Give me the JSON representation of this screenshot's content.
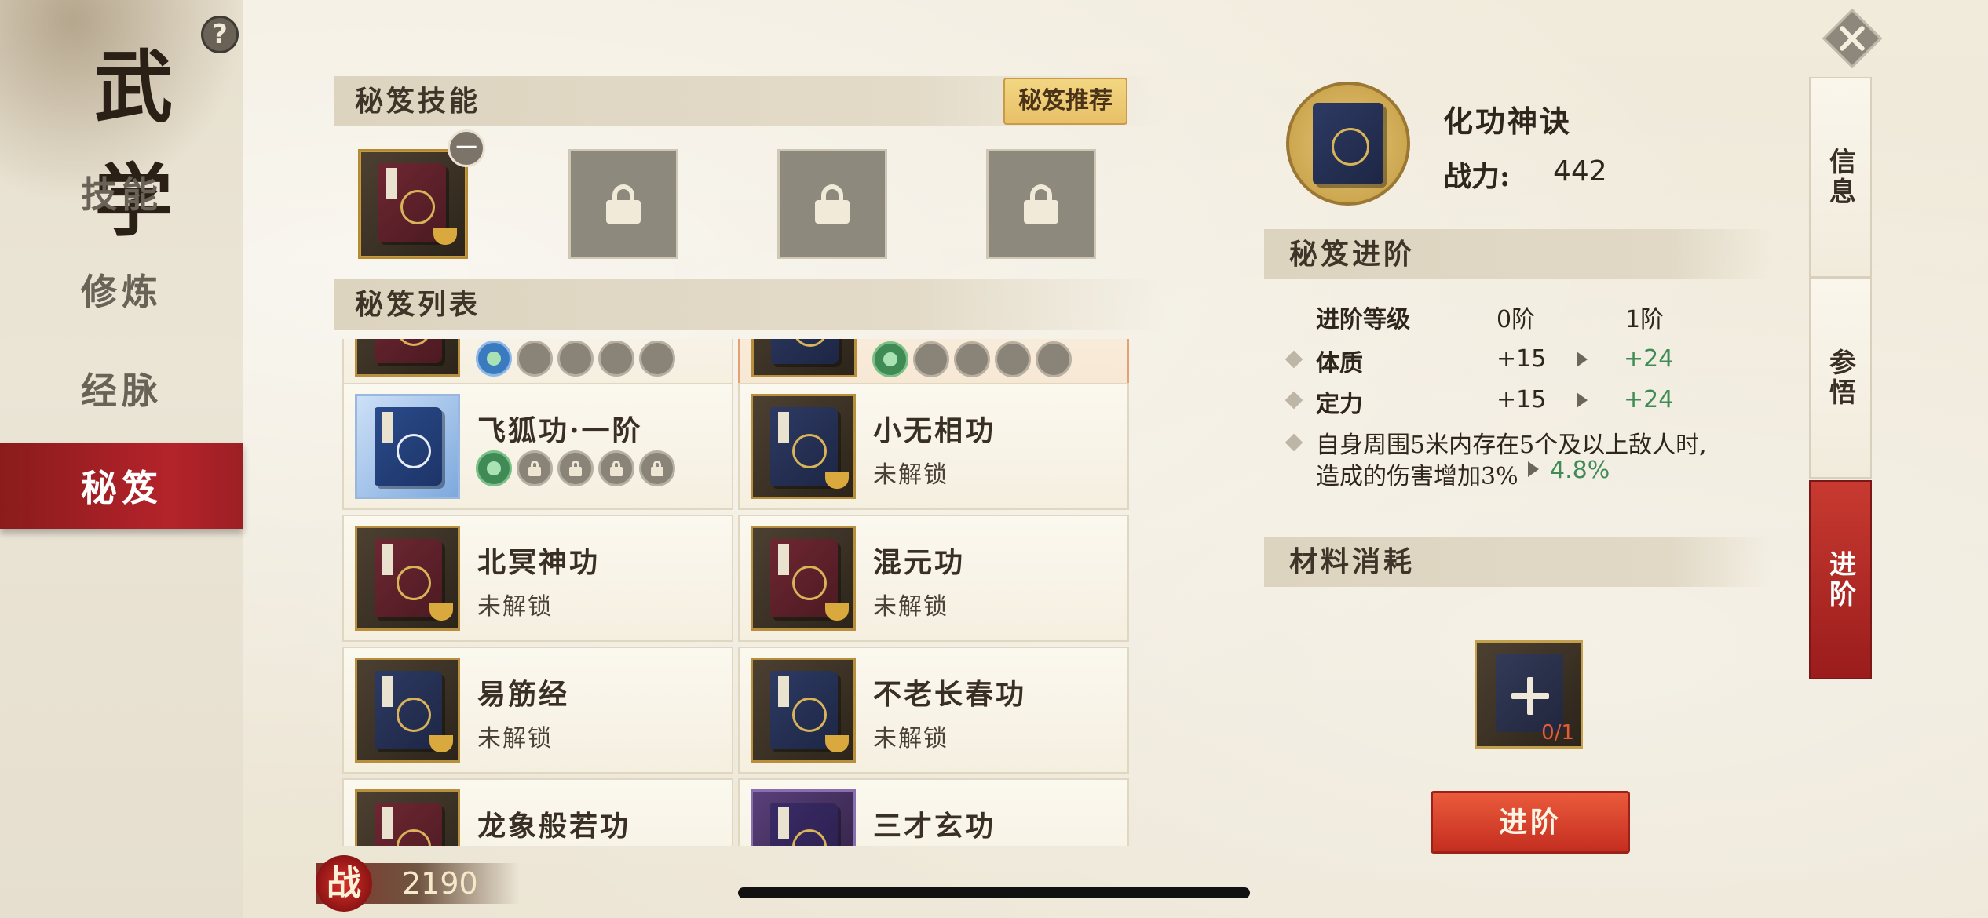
{
  "nav": {
    "title": "武 学",
    "help": "?",
    "items": [
      {
        "label": "技能"
      },
      {
        "label": "修炼"
      },
      {
        "label": "经脉"
      },
      {
        "label": "秘笈"
      }
    ]
  },
  "skills_panel": {
    "title": "秘笈技能",
    "recommend_label": "秘笈推荐",
    "minus_symbol": "−"
  },
  "list_panel": {
    "title": "秘笈列表",
    "cards": [
      {
        "name": "飞狐功·一阶",
        "style": "bluewhite",
        "status": ""
      },
      {
        "name": "小无相功",
        "style": "navy",
        "status": "未解锁"
      },
      {
        "name": "北冥神功",
        "style": "maroon",
        "status": "未解锁"
      },
      {
        "name": "混元功",
        "style": "maroon",
        "status": "未解锁"
      },
      {
        "name": "易筋经",
        "style": "navy",
        "status": "未解锁"
      },
      {
        "name": "不老长春功",
        "style": "navy",
        "status": "未解锁"
      },
      {
        "name": "龙象般若功",
        "style": "maroon",
        "status": ""
      },
      {
        "name": "三才玄功",
        "style": "purple",
        "status": ""
      }
    ]
  },
  "power": {
    "icon": "战",
    "value": "2190"
  },
  "detail": {
    "name": "化功神诀",
    "power_label": "战力:",
    "power_value": "442",
    "advance_section": "秘笈进阶",
    "level_label": "进阶等级",
    "level_from": "0阶",
    "level_to": "1阶",
    "attrs": [
      {
        "name": "体质",
        "from": "+15",
        "to": "+24"
      },
      {
        "name": "定力",
        "from": "+15",
        "to": "+24"
      }
    ],
    "effect_line1": "自身周围5米内存在5个及以上敌人时,",
    "effect_line2": "造成的伤害增加3%",
    "effect_next": "4.8%",
    "material_section": "材料消耗",
    "material_count": "0/1",
    "advance_button": "进阶"
  },
  "right_tabs": [
    {
      "label": "信息"
    },
    {
      "label": "参悟"
    },
    {
      "label": "进阶"
    }
  ]
}
